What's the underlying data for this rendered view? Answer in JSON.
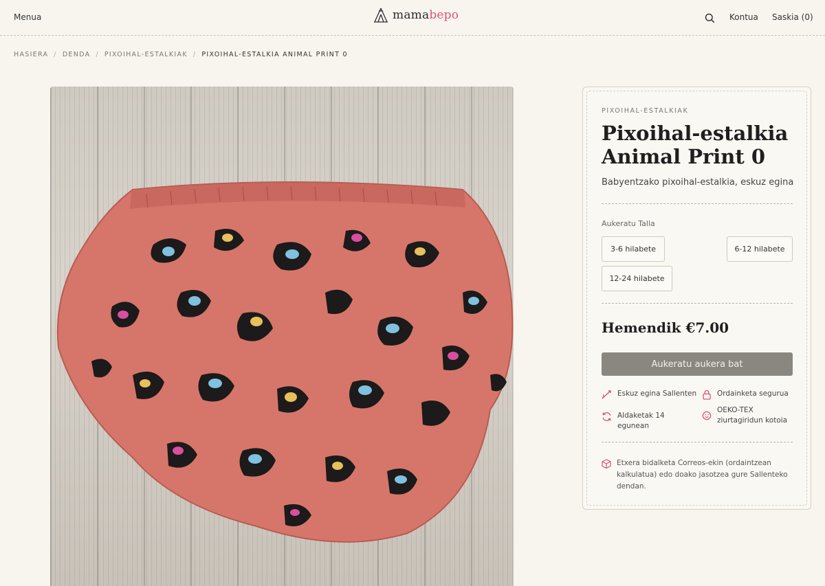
{
  "header": {
    "menu_label": "Menua",
    "logo": {
      "part1": "mama",
      "part2": "bepo"
    },
    "account_label": "Kontua",
    "cart_label": "Saskia (0)"
  },
  "breadcrumb": {
    "items": [
      "HASIERA",
      "DENDA",
      "PIXOIHAL-ESTALKIAK",
      "PIXOIHAL-ESTALKIA ANIMAL PRINT 0"
    ],
    "separator": "/"
  },
  "product": {
    "category": "PIXOIHAL-ESTALKIAK",
    "title": "Pixoihal-estalkia Animal Print 0",
    "subtitle": "Babyentzako pixoihal-estalkia, eskuz egina",
    "size_label": "Aukeratu Talla",
    "sizes": [
      "3-6 hilabete",
      "6-12 hilabete",
      "12-24 hilabete"
    ],
    "price": "Hemendik €7.00",
    "cta_label": "Aukeratu aukera bat",
    "features": [
      {
        "icon": "needle-icon",
        "label": "Eskuz egina Sallenten"
      },
      {
        "icon": "lock-icon",
        "label": "Ordainketa segurua"
      },
      {
        "icon": "refresh-icon",
        "label": "Aldaketak 14 egunean"
      },
      {
        "icon": "smile-icon",
        "label": "OEKO-TEX ziurtagiridun kotoia"
      }
    ],
    "shipping": "Etxera bidalketa Correos-ekin (ordaintzean kalkulatua) edo doako jasotzea gure Sallenteko dendan."
  },
  "colors": {
    "accent": "#d9536f",
    "background": "#f8f5ef",
    "button": "#8a8781",
    "fabric": "#d6766b"
  }
}
